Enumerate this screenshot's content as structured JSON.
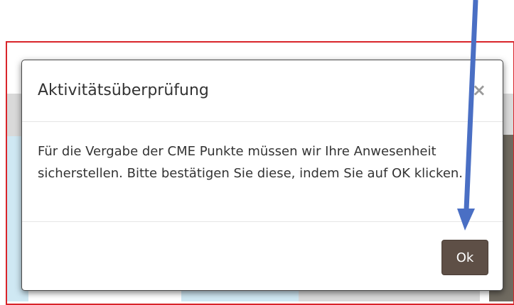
{
  "dialog": {
    "title": "Aktivitätsüberprüfung",
    "close_glyph": "×",
    "message": "Für die Vergabe der CME Punkte müssen wir Ihre Anwesenheit sicherstellen. Bitte bestätigen Sie diese, indem Sie auf OK klicken.",
    "ok_label": "Ok"
  },
  "colors": {
    "annotation_border": "#d9242a",
    "ok_button": "#5e4f46",
    "annotation_arrow": "#4a6fc4"
  },
  "icons": {
    "close": "close-icon",
    "annotation": "down-arrow-icon"
  }
}
